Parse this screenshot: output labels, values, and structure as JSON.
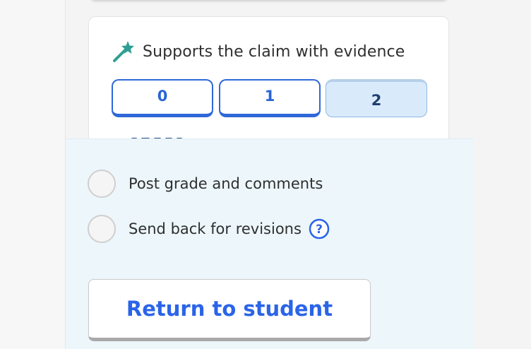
{
  "criterion": {
    "title": "Supports the claim with evidence",
    "icon": "magic-wand-icon",
    "scores": [
      "0",
      "1",
      "2"
    ],
    "selected_score": "2"
  },
  "actions": {
    "options": [
      {
        "label": "Post grade and comments"
      },
      {
        "label": "Send back for revisions"
      }
    ],
    "help_symbol": "?",
    "return_button": "Return to student"
  },
  "colors": {
    "accent": "#2a64e8",
    "selected_bg": "#d9ebfb",
    "panel_bg": "#ecf6fb",
    "wand": "#2e9e94"
  }
}
